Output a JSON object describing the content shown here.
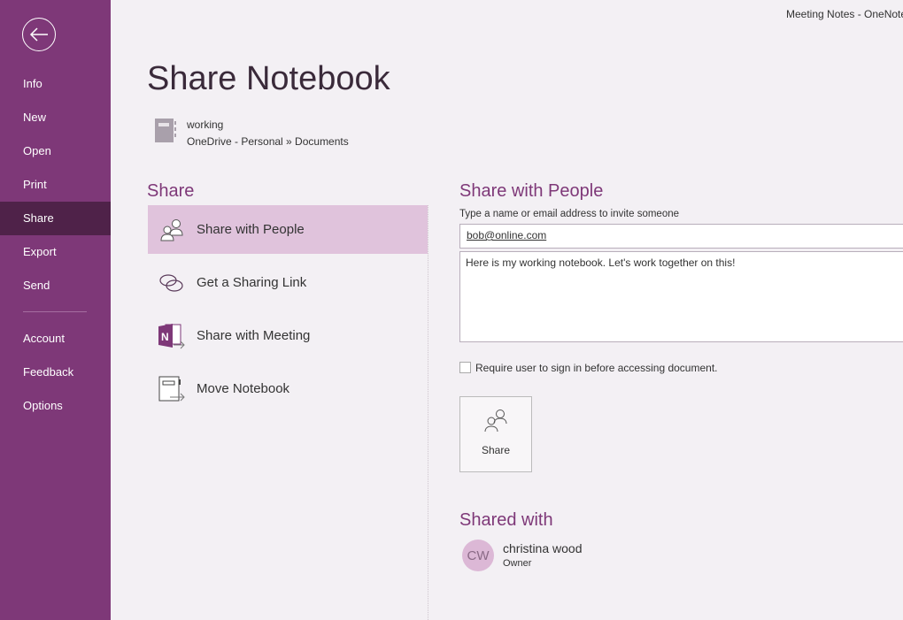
{
  "window": {
    "title": "Meeting Notes  -  OneNote"
  },
  "sidebar": {
    "items": [
      {
        "label": "Info"
      },
      {
        "label": "New"
      },
      {
        "label": "Open"
      },
      {
        "label": "Print"
      },
      {
        "label": "Share",
        "active": true
      },
      {
        "label": "Export"
      },
      {
        "label": "Send"
      },
      {
        "label": "Account"
      },
      {
        "label": "Feedback"
      },
      {
        "label": "Options"
      }
    ]
  },
  "page": {
    "title": "Share Notebook",
    "notebook_name": "working",
    "notebook_path": "OneDrive - Personal » Documents"
  },
  "share": {
    "heading": "Share",
    "options": [
      {
        "label": "Share with People",
        "icon": "people-icon"
      },
      {
        "label": "Get a Sharing Link",
        "icon": "link-icon"
      },
      {
        "label": "Share with Meeting",
        "icon": "onenote-meeting-icon"
      },
      {
        "label": "Move Notebook",
        "icon": "move-notebook-icon"
      }
    ]
  },
  "share_with_people": {
    "heading": "Share with People",
    "invite_label": "Type a name or email address to invite someone",
    "email_value": "bob@online.com",
    "message_value": "Here is my working notebook. Let's work together on this!",
    "require_signin_label": "Require user to sign in before accessing document.",
    "require_signin_checked": false,
    "share_button": "Share"
  },
  "shared_with": {
    "heading": "Shared with",
    "people": [
      {
        "initials": "CW",
        "name": "christina wood",
        "role": "Owner"
      }
    ]
  },
  "colors": {
    "accent": "#7e3878",
    "selected": "#e0c3dc",
    "background": "#f3f0f4"
  }
}
